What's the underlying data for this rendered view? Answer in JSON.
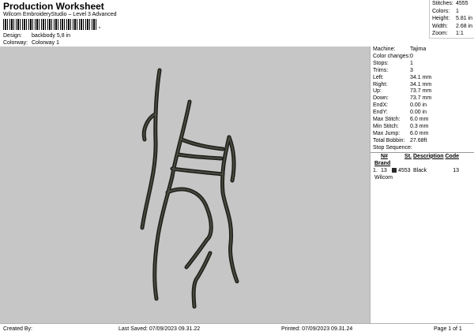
{
  "header": {
    "title": "Production Worksheet",
    "subtitle": "Wilcom EmbroideryStudio – Level 3 Advanced",
    "barcode_mark": ",",
    "design_label": "Design:",
    "design_value": "backbody 5,8 in",
    "colorway_label": "Colorway:",
    "colorway_value": "Colorway 1"
  },
  "summary": {
    "stitches_label": "Stitches:",
    "stitches": "4555",
    "colors_label": "Colors:",
    "colors": "1",
    "height_label": "Height:",
    "height": "5.81 in",
    "width_label": "Width:",
    "width": "2.68 in",
    "zoom_label": "Zoom:",
    "zoom": "1:1"
  },
  "details": [
    {
      "label": "Machine:",
      "value": "Tajima"
    },
    {
      "label": "Color changes:",
      "value": "0"
    },
    {
      "label": "Stops:",
      "value": "1"
    },
    {
      "label": "Trims:",
      "value": "3"
    },
    {
      "label": "Left:",
      "value": "34.1 mm"
    },
    {
      "label": "Right:",
      "value": "34.1 mm"
    },
    {
      "label": "Up:",
      "value": "73.7 mm"
    },
    {
      "label": "Down:",
      "value": "73.7 mm"
    },
    {
      "label": "EndX:",
      "value": "0.00 in"
    },
    {
      "label": "EndY:",
      "value": "0.00 in"
    },
    {
      "label": "Max Stitch:",
      "value": "6.0 mm"
    },
    {
      "label": "Min Stitch:",
      "value": "0.3 mm"
    },
    {
      "label": "Max Jump:",
      "value": "6.0 mm"
    },
    {
      "label": "Total Bobbin:",
      "value": "27.68ft"
    }
  ],
  "stop_sequence": {
    "title": "Stop Sequence:",
    "headers": [
      "N#",
      "St.",
      "Description",
      "Code",
      "Brand"
    ],
    "rows": [
      {
        "index": "1.",
        "n": "13",
        "st": "4553",
        "description": "Black",
        "code": "13",
        "brand": "Wilcom",
        "color": "#2a2a2a"
      }
    ]
  },
  "footer": {
    "created_by": "Created By:",
    "last_saved": "Last Saved: 07/09/2023 09.31.22",
    "printed": "Printed: 07/09/2023 09.31.24",
    "page": "Page 1 of 1"
  },
  "colors": {
    "canvas_bg": "#c6c6c6",
    "thread": "#3a3a32"
  }
}
